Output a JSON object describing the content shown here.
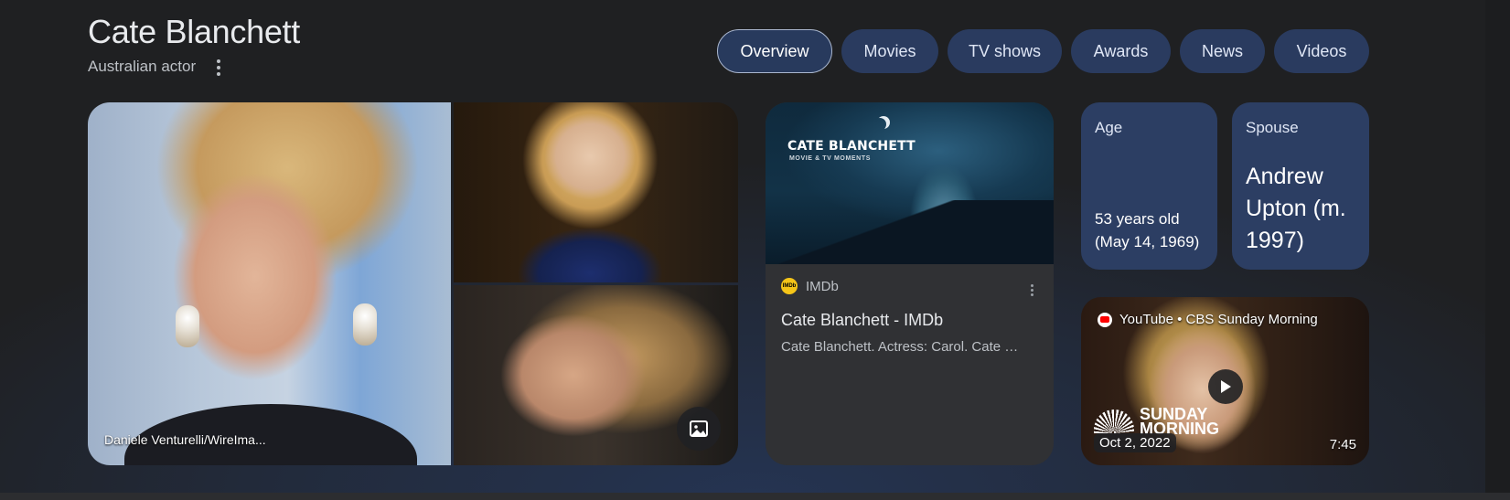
{
  "entity": {
    "title": "Cate Blanchett",
    "subtitle": "Australian actor"
  },
  "tabs": [
    {
      "label": "Overview",
      "active": true
    },
    {
      "label": "Movies"
    },
    {
      "label": "TV shows"
    },
    {
      "label": "Awards"
    },
    {
      "label": "News"
    },
    {
      "label": "Videos"
    }
  ],
  "images": {
    "caption": "Daniele Venturelli/WireIma...",
    "more_images_icon": "image-icon"
  },
  "imdb_card": {
    "thumbnail_title": "CATE BLANCHETT",
    "thumbnail_subtitle": "MOVIE & TV MOMENTS",
    "source_logo_text": "IMDb",
    "source": "IMDb",
    "title": "Cate Blanchett - IMDb",
    "snippet": "Cate Blanchett. Actress: Carol. Cate Blanchett..."
  },
  "facts": {
    "age": {
      "label": "Age",
      "value_line1": "53 years old",
      "value_line2": "(May 14, 1969)"
    },
    "spouse": {
      "label": "Spouse",
      "value": "Andrew Upton (m. 1997)"
    }
  },
  "video": {
    "source": "YouTube • CBS Sunday Morning",
    "show_line1": "SUNDAY",
    "show_line2": "MORNING",
    "date": "Oct 2, 2022",
    "duration": "7:45"
  },
  "colors": {
    "tab_bg": "#2a3b5f",
    "card_bg": "#303134",
    "fact_bg": "#2c3e63",
    "imdb_yellow": "#f5c518",
    "youtube_red": "#ff0000"
  }
}
